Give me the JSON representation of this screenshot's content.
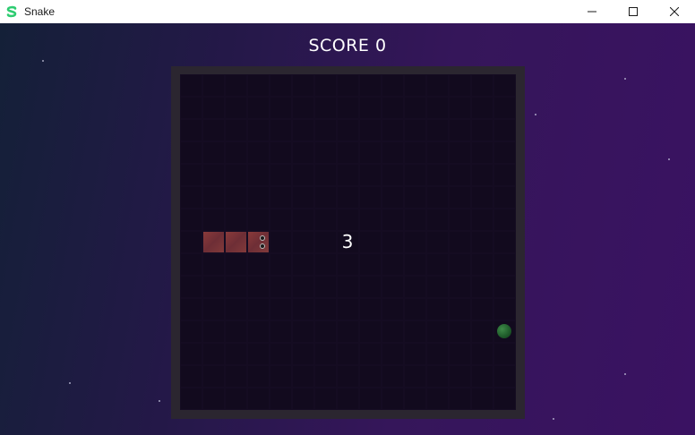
{
  "window": {
    "title": "Snake",
    "app_icon": "snake-app-icon",
    "accent": "#2ecc71"
  },
  "game": {
    "score_text": "SCORE 0",
    "countdown": "3",
    "grid": {
      "cols": 15,
      "rows": 15
    },
    "snake": {
      "color": "#7a3438",
      "segments": [
        {
          "col": 1,
          "row": 7
        },
        {
          "col": 2,
          "row": 7
        },
        {
          "col": 3,
          "row": 7
        }
      ],
      "head": {
        "col": 3,
        "row": 7,
        "direction": "right"
      }
    },
    "food": {
      "col": 14,
      "row": 11,
      "color": "#2a6e36"
    }
  }
}
